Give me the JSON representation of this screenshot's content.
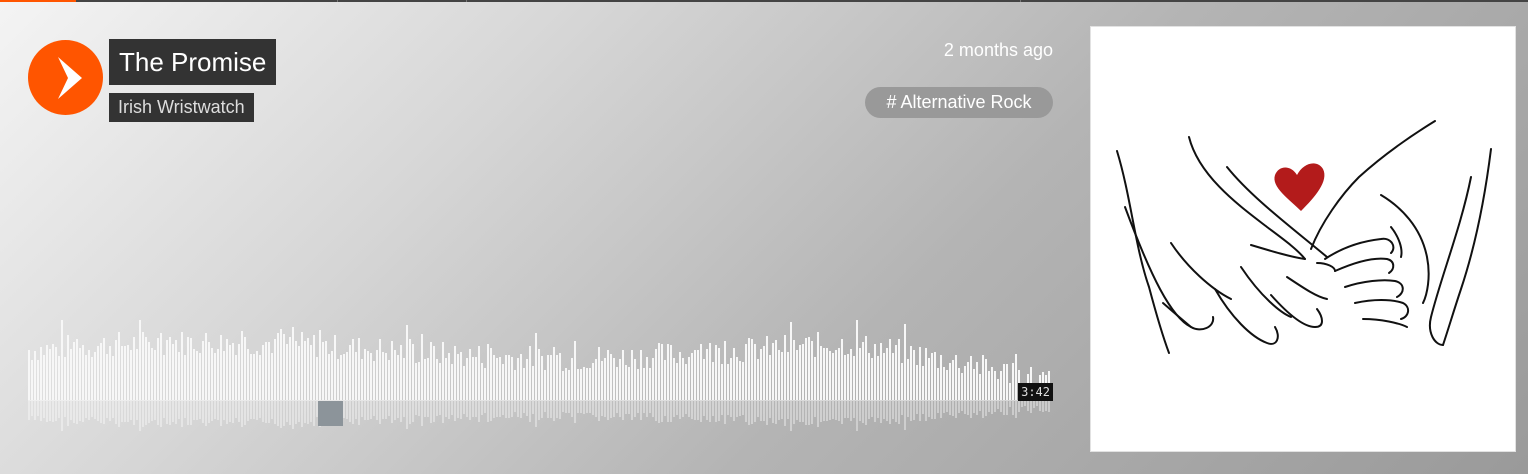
{
  "track": {
    "title": "The Promise",
    "artist": "Irish Wristwatch",
    "posted": "2 months ago",
    "genre_tag": "# Alternative Rock",
    "duration": "3:42"
  },
  "colors": {
    "accent": "#ff5500",
    "label_bg": "#333333",
    "heart": "#b31b1b"
  },
  "icons": {
    "play": "play-icon"
  },
  "artwork": {
    "description_name": "pinky-promise-hands-artwork"
  }
}
